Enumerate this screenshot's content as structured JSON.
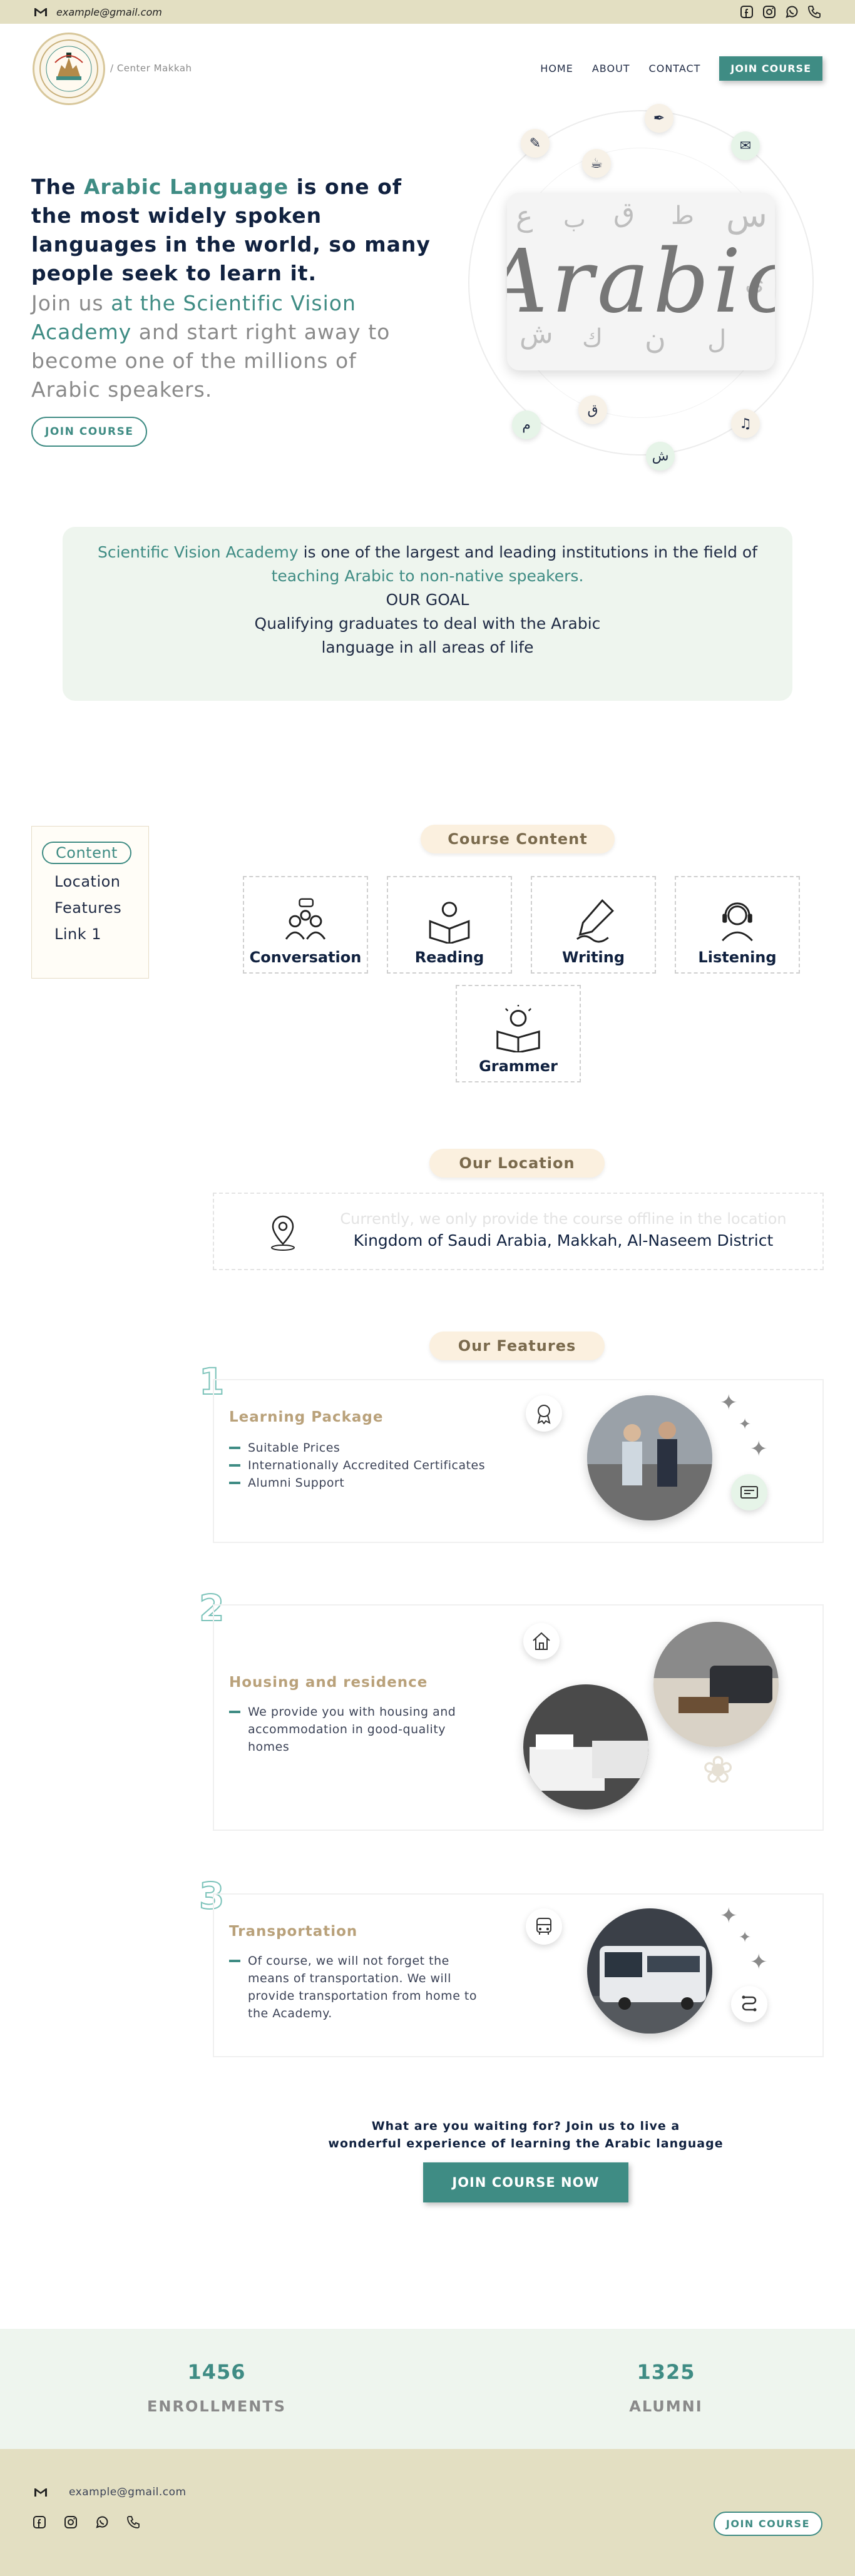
{
  "topbar": {
    "email": "example@gmail.com",
    "socials": [
      "facebook-icon",
      "instagram-icon",
      "whatsapp-icon",
      "phone-icon"
    ]
  },
  "header": {
    "breadcrumb": "/ Center Makkah",
    "nav": [
      "HOME",
      "ABOUT",
      "CONTACT"
    ],
    "join_button": "JOIN COURSE"
  },
  "hero": {
    "title_prefix": "The ",
    "title_accent": "Arabic Language",
    "title_suffix": " is one of the most widely spoken languages in the world, so many people seek to learn it.",
    "sub_prefix": "Join us ",
    "sub_accent": "at the Scientific Vision Academy",
    "sub_suffix": " and start right away to become one of the millions of Arabic speakers.",
    "button": "JOIN COURSE",
    "image_word": "Arabic"
  },
  "mission": {
    "accent1": "Scientific Vision Academy",
    "text1": " is one of the largest and leading institutions in the field of ",
    "accent2": "teaching Arabic to non-native speakers.",
    "goal_title": "OUR GOAL",
    "goal_text": "Qualifying graduates to deal with the Arabic language in all areas of life"
  },
  "sidebar": {
    "items": [
      "Content",
      "Location",
      "Features",
      "Link 1"
    ]
  },
  "course_content": {
    "title": "Course Content",
    "items": [
      "Conversation",
      "Reading",
      "Writing",
      "Listening",
      "Grammer"
    ]
  },
  "location": {
    "title": "Our Location",
    "faded_text": "Currently, we only provide the course offline in the location",
    "address": "Kingdom of Saudi Arabia, Makkah, Al-Naseem District"
  },
  "features": {
    "title": "Our Features",
    "items": [
      {
        "number": "1",
        "title": "Learning Package",
        "points": [
          "Suitable Prices",
          "Internationally Accredited Certificates",
          "Alumni Support"
        ]
      },
      {
        "number": "2",
        "title": "Housing and residence",
        "points": [
          "We provide you with housing and accommodation in good-quality homes"
        ]
      },
      {
        "number": "3",
        "title": "Transportation",
        "points": [
          "Of course, we will not forget the means of transportation. We will provide transportation from home to the Academy."
        ]
      }
    ]
  },
  "cta": {
    "line1": "What are you waiting for? Join us to live a",
    "line2": "wonderful experience of learning the Arabic language",
    "button": "JOIN COURSE NOW"
  },
  "stats": {
    "enrollments_value": "1456",
    "enrollments_label": "ENROLLMENTS",
    "alumni_value": "1325",
    "alumni_label": "ALUMNI"
  },
  "footer": {
    "email": "example@gmail.com",
    "button": "JOIN COURSE"
  },
  "colors": {
    "accent": "#3f8c84",
    "topbar_bg": "#e3dfc2",
    "panel_bg": "#eef5ee",
    "feature_title": "#b9a17a"
  }
}
